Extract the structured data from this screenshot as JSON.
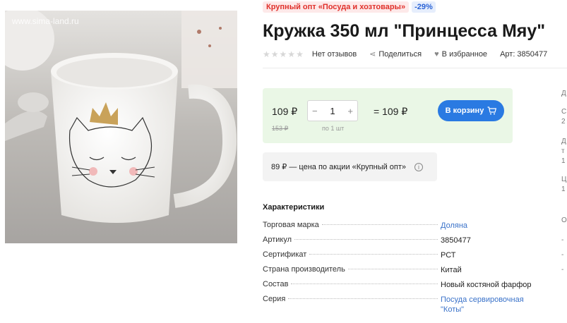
{
  "photo": {
    "watermark": "www.sima-land.ru"
  },
  "promo": {
    "tag": "Крупный опт «Посуда и хозтовары»",
    "discount": "-29%"
  },
  "product": {
    "title": "Кружка 350 мл \"Принцесса Мяу\"",
    "rating_stars": 5,
    "reviews": "Нет отзывов",
    "share": "Поделиться",
    "favorite": "В избранное",
    "article": "Арт: 3850477"
  },
  "price": {
    "current": "109 ₽",
    "old": "153 ₽",
    "quantity": "1",
    "per_unit": "по 1 шт",
    "total": "= 109 ₽",
    "cart_button": "В корзину"
  },
  "wholesale": {
    "text": "89 ₽ — цена по акции «Крупный опт»"
  },
  "characteristics": {
    "title": "Характеристики",
    "rows": [
      {
        "key": "Торговая марка",
        "value": "Доляна",
        "link": true
      },
      {
        "key": "Артикул",
        "value": "3850477",
        "link": false
      },
      {
        "key": "Сертификат",
        "value": "РСТ",
        "link": false
      },
      {
        "key": "Страна производитель",
        "value": "Китай",
        "link": false
      },
      {
        "key": "Состав",
        "value": "Новый костяной фарфор",
        "link": false
      },
      {
        "key": "Серия",
        "value": "Посуда сервировочная \"Коты\"",
        "link": true
      }
    ]
  },
  "right_column": {
    "items": [
      "Д",
      "С",
      "2",
      "Д",
      "т",
      "1",
      "Ц",
      "1",
      "О",
      "-",
      "-",
      "-"
    ]
  },
  "colors": {
    "accent": "#2a7ae2",
    "promo_red": "#e0302a",
    "price_bg": "#eaf7e6",
    "link": "#3a72c9"
  }
}
